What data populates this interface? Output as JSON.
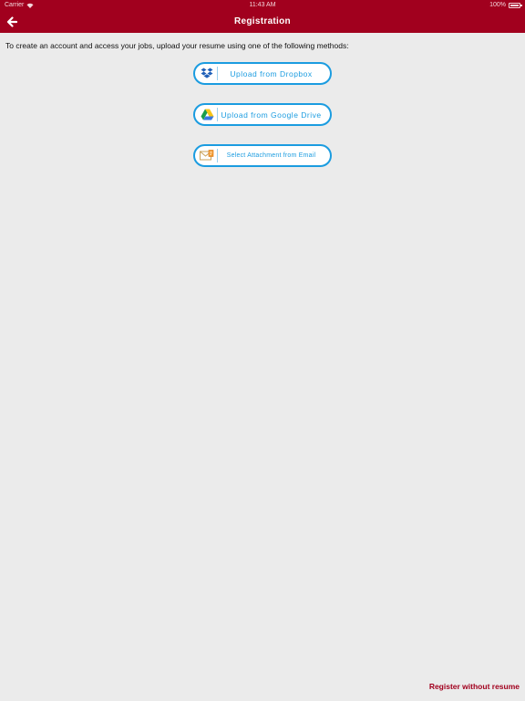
{
  "status_bar": {
    "carrier": "Carrier",
    "time": "11:43 AM",
    "battery": "100%"
  },
  "nav": {
    "title": "Registration",
    "back_icon": "arrow-left-icon"
  },
  "intro_text": "To create an account and access your jobs, upload your resume using one of the following methods:",
  "upload_options": [
    {
      "label": "Upload from Dropbox",
      "icon": "dropbox-icon"
    },
    {
      "label": "Upload from Google Drive",
      "icon": "google-drive-icon"
    },
    {
      "label": "Select Attachment from Email",
      "icon": "email-icon"
    }
  ],
  "register_without_resume": "Register without resume",
  "colors": {
    "brand_red": "#a1001e",
    "button_blue": "#1b9ce0",
    "background": "#ebebeb"
  }
}
